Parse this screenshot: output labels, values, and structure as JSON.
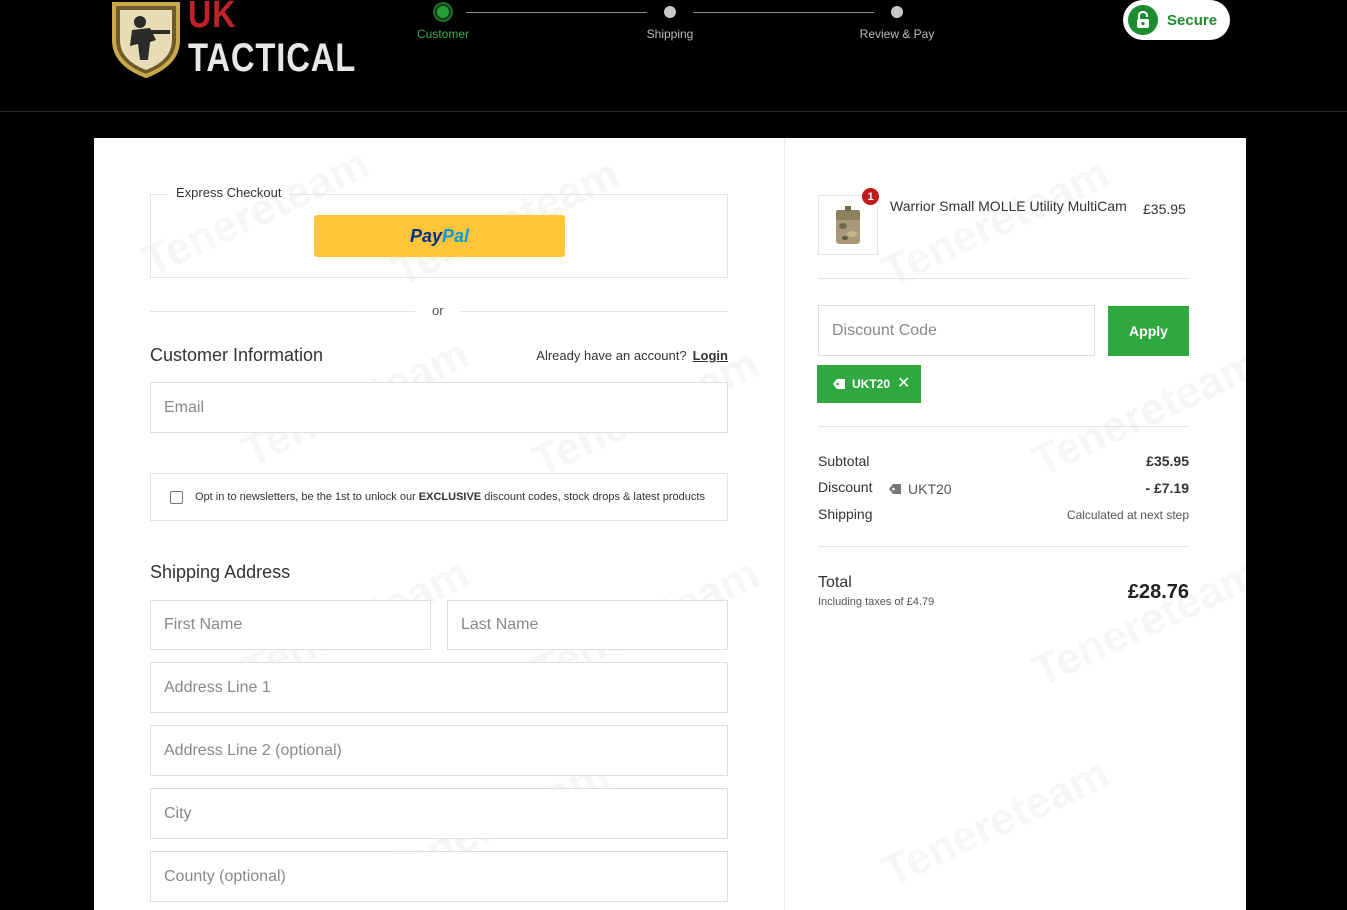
{
  "brand": {
    "logo_top": "UK",
    "logo_bottom": "TACTICAL"
  },
  "steps": [
    {
      "label": "Customer",
      "active": true
    },
    {
      "label": "Shipping",
      "active": false
    },
    {
      "label": "Review & Pay",
      "active": false
    }
  ],
  "secure_label": "Secure",
  "express": {
    "label": "Express Checkout",
    "paypal_pay": "Pay",
    "paypal_pal": "Pal"
  },
  "or_text": "or",
  "customer": {
    "title": "Customer Information",
    "account_prompt": "Already have an account?",
    "login_label": "Login",
    "email_placeholder": "Email",
    "newsletter_pre": "Opt in to newsletters, be the 1st to unlock our",
    "newsletter_bold": "EXCLUSIVE",
    "newsletter_post": "discount codes, stock drops & latest products"
  },
  "shipping_address": {
    "title": "Shipping Address",
    "first_name_placeholder": "First Name",
    "last_name_placeholder": "Last Name",
    "address1_placeholder": "Address Line 1",
    "address2_placeholder": "Address Line 2 (optional)",
    "city_placeholder": "City",
    "county_placeholder": "County (optional)"
  },
  "cart": {
    "quantity": "1",
    "product_name": "Warrior Small MOLLE Utility MultiCam",
    "product_price": "£35.95",
    "discount_placeholder": "Discount Code",
    "apply_label": "Apply",
    "applied_code": "UKT20"
  },
  "summary": {
    "subtotal_label": "Subtotal",
    "subtotal_value": "£35.95",
    "discount_label": "Discount",
    "discount_code": "UKT20",
    "discount_value": "- £7.19",
    "shipping_label": "Shipping",
    "shipping_value": "Calculated at next step",
    "total_label": "Total",
    "total_sub": "Including taxes of £4.79",
    "total_value": "£28.76"
  },
  "watermark_text": "Tenereteam",
  "colors": {
    "accent_green": "#2fa83f",
    "badge_red": "#c01a1a",
    "paypal_yellow": "#ffc439"
  }
}
